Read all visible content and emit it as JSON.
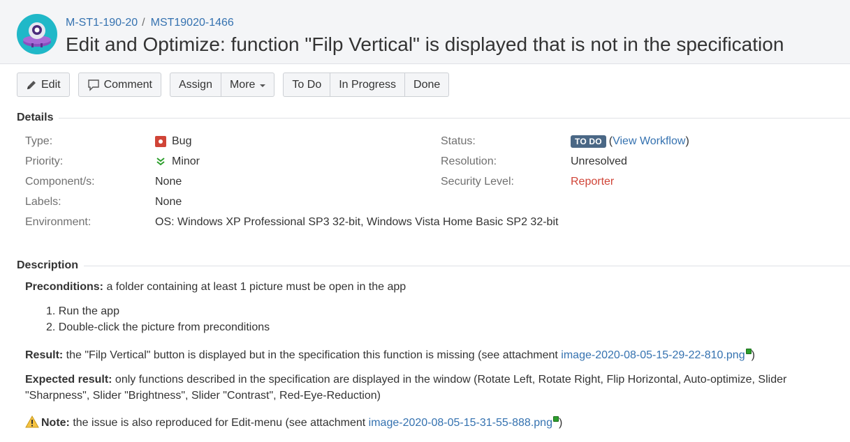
{
  "header": {
    "breadcrumb_project": "M-ST1-190-20",
    "breadcrumb_separator": "/",
    "breadcrumb_issue": "MST19020-1466",
    "summary": "Edit and Optimize: function \"Filp Vertical\" is displayed that is not in the specification"
  },
  "toolbar": {
    "edit": "Edit",
    "comment": "Comment",
    "assign": "Assign",
    "more": "More",
    "todo": "To Do",
    "in_progress": "In Progress",
    "done": "Done"
  },
  "details": {
    "title": "Details",
    "type_label": "Type:",
    "type_value": "Bug",
    "priority_label": "Priority:",
    "priority_value": "Minor",
    "components_label": "Component/s:",
    "components_value": "None",
    "labels_label": "Labels:",
    "labels_value": "None",
    "environment_label": "Environment:",
    "environment_value": "OS: Windows XP Professional SP3 32-bit, Windows Vista Home Basic SP2 32-bit",
    "status_label": "Status:",
    "status_value": "TO DO",
    "view_workflow": "View Workflow",
    "paren_open": "(",
    "paren_close": ")",
    "resolution_label": "Resolution:",
    "resolution_value": "Unresolved",
    "security_label": "Security Level:",
    "security_value": "Reporter"
  },
  "description": {
    "title": "Description",
    "preconditions_label": "Preconditions:",
    "preconditions_text": " a folder containing at least 1 picture must be open in the app",
    "steps": [
      "Run the app",
      "Double-click the picture from preconditions"
    ],
    "result_label": "Result:",
    "result_text": " the \"Filp Vertical\" button is displayed but in the specification this function is missing (see attachment ",
    "result_link": "image-2020-08-05-15-29-22-810.png",
    "result_end": ")",
    "expected_label": "Expected result:",
    "expected_text_1": " only functions described in the specification are displayed in the window (Rotate Left, Rotate Right, Flip Horizontal, Auto-optimize, Slider",
    "expected_text_2": "\"Sharpness\", Slider \"Brightness\", Slider \"Contrast\", Red-Eye-Reduction)",
    "note_label": "Note:",
    "note_text": " the issue is also reproduced for Edit-menu (see attachment ",
    "note_link": "image-2020-08-05-15-31-55-888.png",
    "note_end": ")"
  },
  "colors": {
    "link": "#3572b0",
    "status_lozenge": "#4a6785",
    "bug": "#d04437",
    "security": "#d04437",
    "minor_priority": "#2c9e2c"
  },
  "icons": {
    "avatar": "project-avatar",
    "edit": "pencil-icon",
    "comment": "speech-bubble-icon",
    "bug": "bug-icon",
    "priority": "double-chevron-down-icon",
    "note": "warning-icon",
    "attachment": "attachment-icon"
  }
}
